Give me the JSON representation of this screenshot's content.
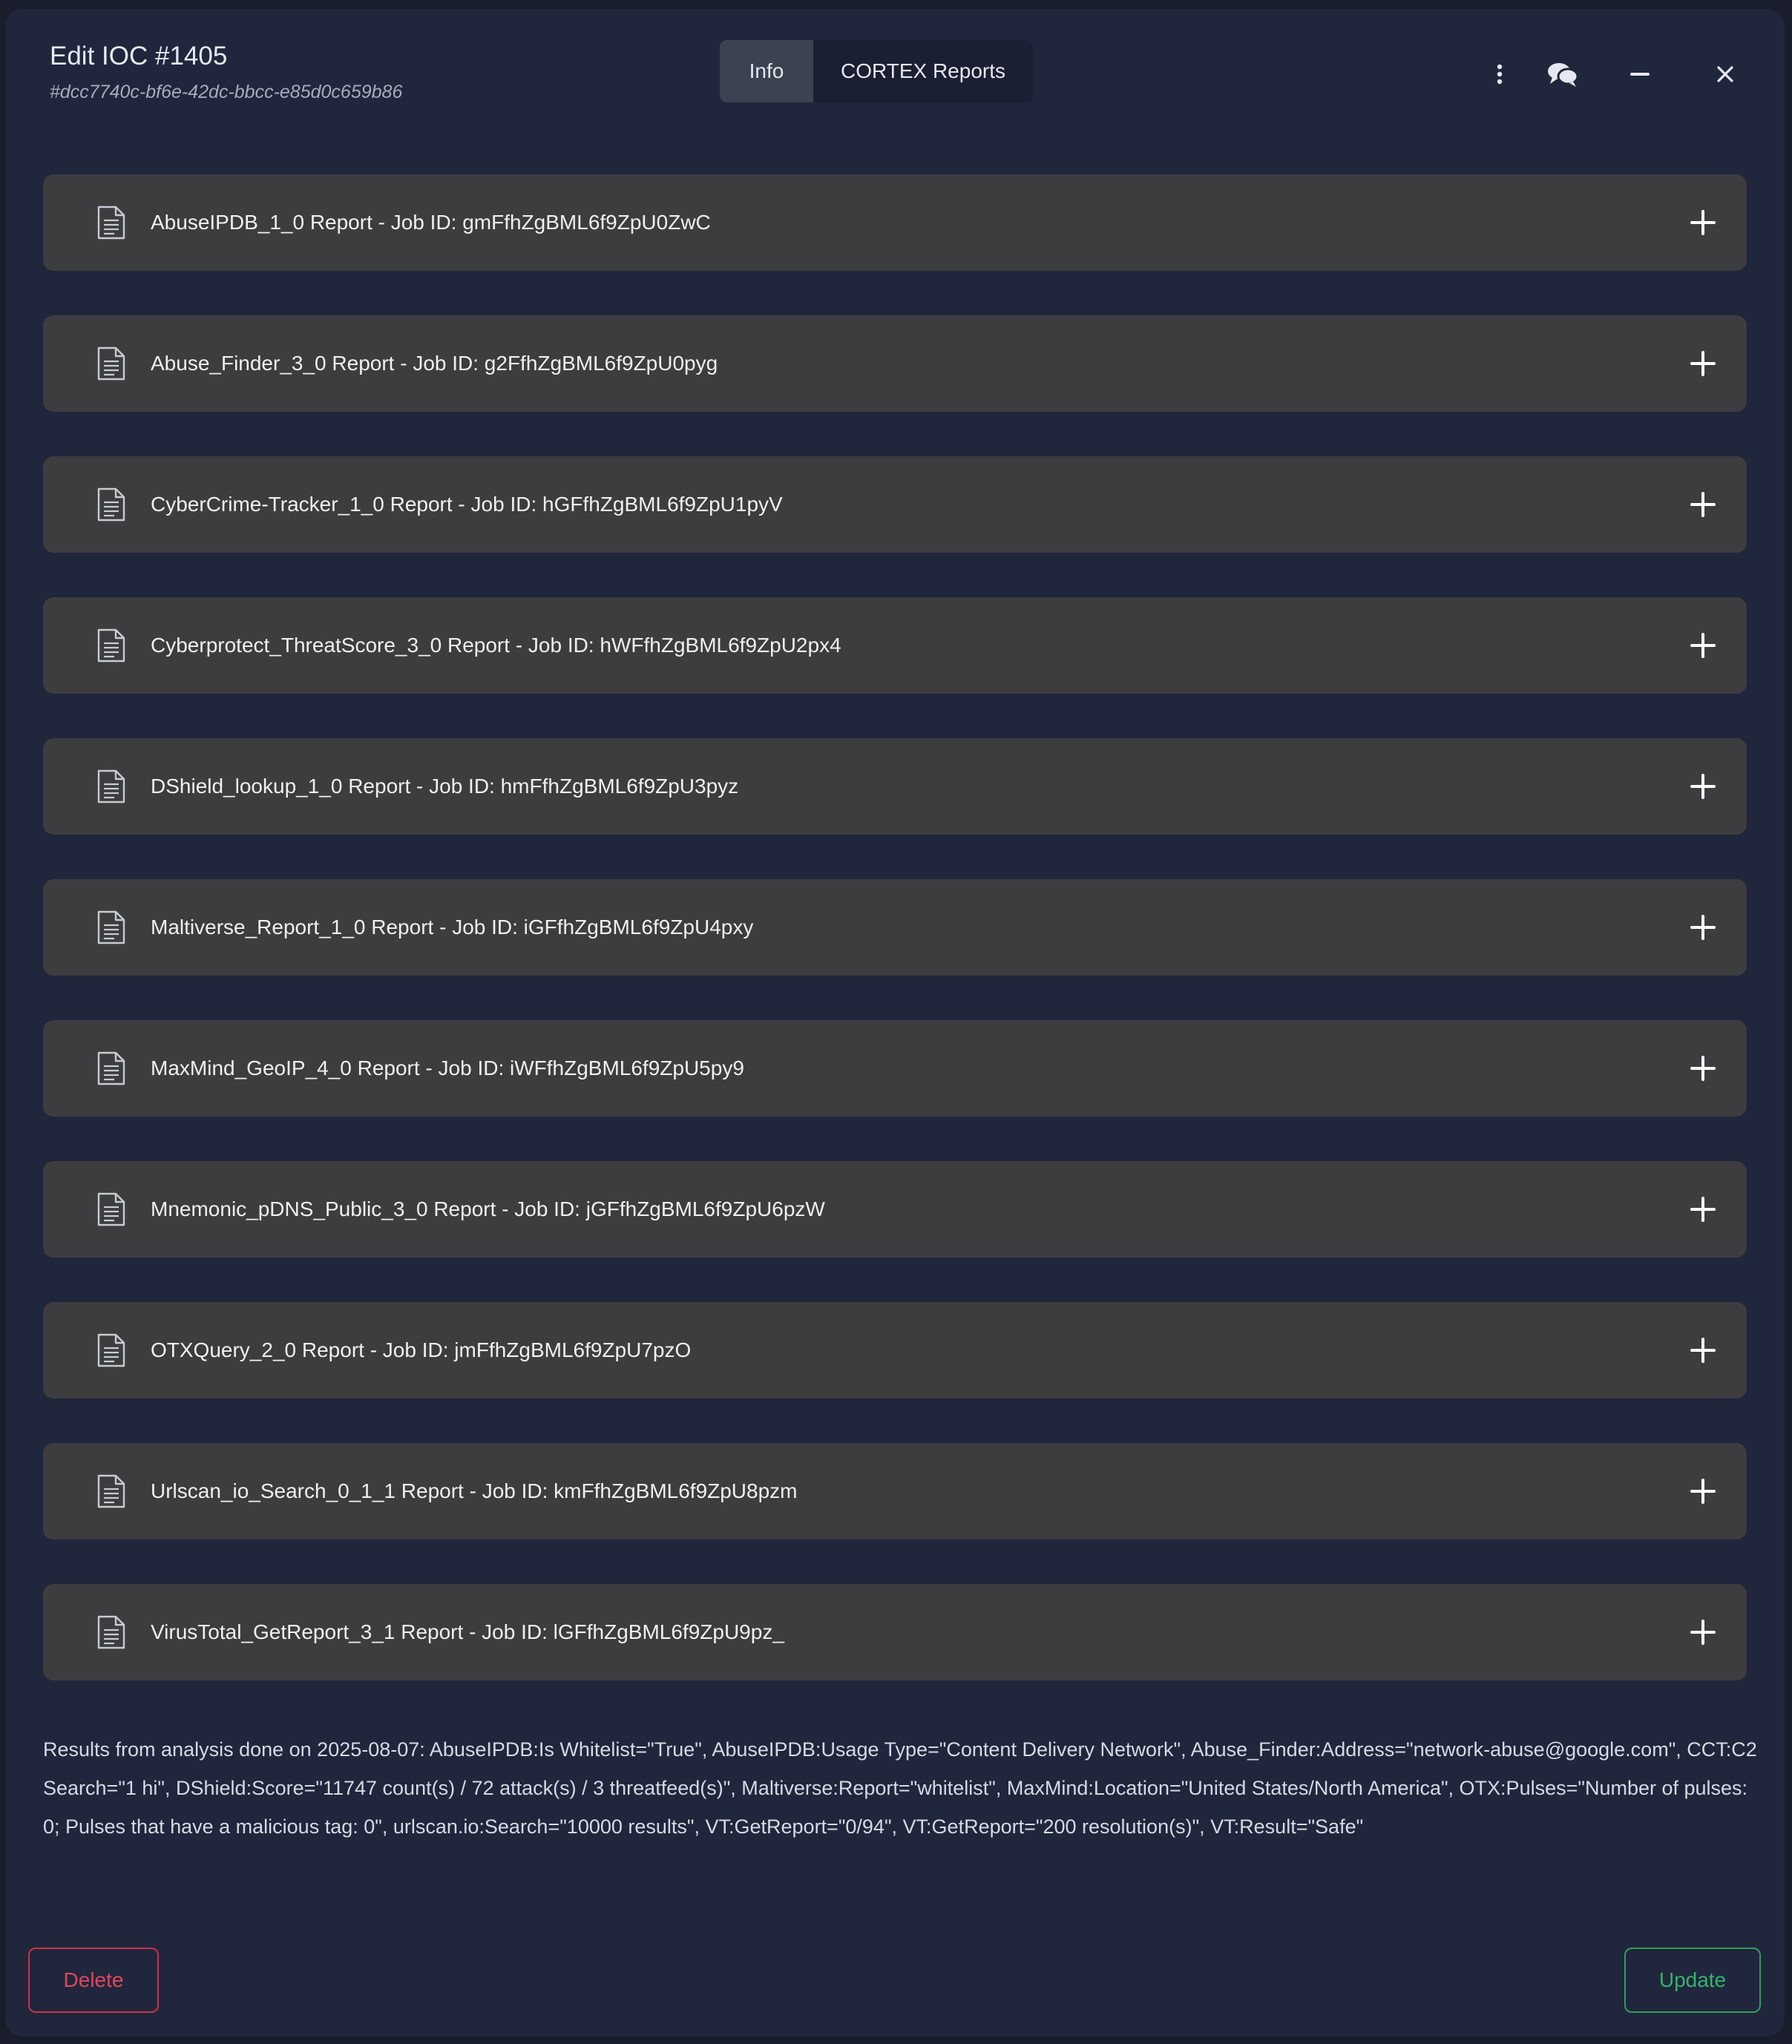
{
  "modal": {
    "title": "Edit IOC #1405",
    "subtitle": "#dcc7740c-bf6e-42dc-bbcc-e85d0c659b86"
  },
  "tabs": [
    {
      "label": "Info",
      "active": true
    },
    {
      "label": "CORTEX Reports",
      "active": false
    }
  ],
  "header_icons": [
    "more-vertical-icon",
    "comments-icon",
    "minimize-icon",
    "close-icon"
  ],
  "reports": [
    {
      "label": "AbuseIPDB_1_0 Report - Job ID: gmFfhZgBML6f9ZpU0ZwC"
    },
    {
      "label": "Abuse_Finder_3_0 Report - Job ID: g2FfhZgBML6f9ZpU0pyg"
    },
    {
      "label": "CyberCrime-Tracker_1_0 Report - Job ID: hGFfhZgBML6f9ZpU1pyV"
    },
    {
      "label": "Cyberprotect_ThreatScore_3_0 Report - Job ID: hWFfhZgBML6f9ZpU2px4"
    },
    {
      "label": "DShield_lookup_1_0 Report - Job ID: hmFfhZgBML6f9ZpU3pyz"
    },
    {
      "label": "Maltiverse_Report_1_0 Report - Job ID: iGFfhZgBML6f9ZpU4pxy"
    },
    {
      "label": "MaxMind_GeoIP_4_0 Report - Job ID: iWFfhZgBML6f9ZpU5py9"
    },
    {
      "label": "Mnemonic_pDNS_Public_3_0 Report - Job ID: jGFfhZgBML6f9ZpU6pzW"
    },
    {
      "label": "OTXQuery_2_0 Report - Job ID: jmFfhZgBML6f9ZpU7pzO"
    },
    {
      "label": "Urlscan_io_Search_0_1_1 Report - Job ID: kmFfhZgBML6f9ZpU8pzm"
    },
    {
      "label": "VirusTotal_GetReport_3_1 Report - Job ID: lGFfhZgBML6f9ZpU9pz_"
    }
  ],
  "results_text": "Results from analysis done on 2025-08-07: AbuseIPDB:Is Whitelist=\"True\", AbuseIPDB:Usage Type=\"Content Delivery Network\", Abuse_Finder:Address=\"network-abuse@google.com\", CCT:C2 Search=\"1 hi\", DShield:Score=\"11747 count(s) / 72 attack(s) / 3 threatfeed(s)\", Maltiverse:Report=\"whitelist\", MaxMind:Location=\"United States/North America\", OTX:Pulses=\"Number of pulses: 0; Pulses that have a malicious tag: 0\", urlscan.io:Search=\"10000 results\", VT:GetReport=\"0/94\", VT:GetReport=\"200 resolution(s)\", VT:Result=\"Safe\"",
  "footer": {
    "delete_label": "Delete",
    "update_label": "Update"
  },
  "colors": {
    "background": "#1a1d2b",
    "modal": "#20263c",
    "report_row": "#3d3d3f",
    "delete": "#e0475c",
    "update": "#35b36a"
  }
}
